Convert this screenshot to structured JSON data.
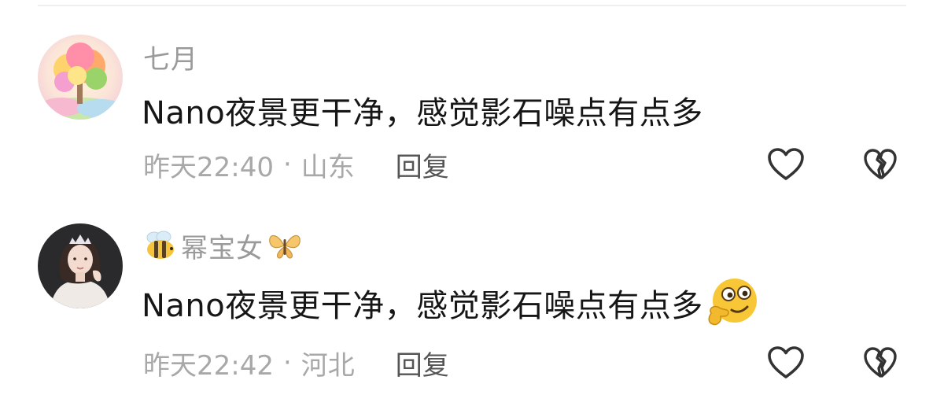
{
  "comments": [
    {
      "username": "七月",
      "text": "Nano夜景更干净，感觉影石噪点有点多",
      "time": "昨天22:40",
      "separator": "·",
      "location": "山东",
      "reply_label": "回复",
      "avatar_icon": "rainbow-tree-avatar",
      "like_icon": "heart-outline-icon",
      "dislike_icon": "broken-heart-icon"
    },
    {
      "username": "幂宝女",
      "username_prefix_icon": "bee-icon",
      "username_suffix_icon": "butterfly-icon",
      "text": "Nano夜景更干净，感觉影石噪点有点多",
      "text_emoji": "thinking-smirk-emoji",
      "time": "昨天22:42",
      "separator": "·",
      "location": "河北",
      "reply_label": "回复",
      "avatar_icon": "woman-with-tiara-avatar",
      "like_icon": "heart-outline-icon",
      "dislike_icon": "broken-heart-icon"
    }
  ],
  "colors": {
    "username": "#9a9a9a",
    "text": "#161616",
    "meta": "#a8a8a8",
    "reply": "#555555",
    "icon_stroke": "#333333"
  }
}
